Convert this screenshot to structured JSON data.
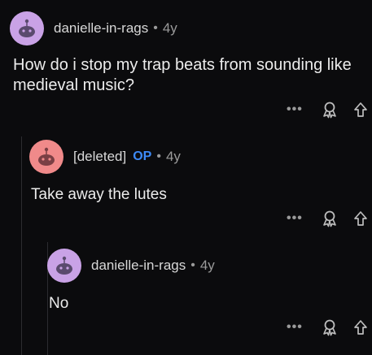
{
  "post": {
    "author": "danielle-in-rags",
    "separator": "•",
    "age": "4y",
    "title": "How do i stop my trap beats from sounding like medieval music?"
  },
  "reply1": {
    "author": "[deleted]",
    "op_badge": "OP",
    "separator": "•",
    "age": "4y",
    "body": "Take away the lutes"
  },
  "reply2": {
    "author": "danielle-in-rags",
    "separator": "•",
    "age": "4y",
    "body": "No"
  },
  "actions": {
    "more_label": "•••"
  },
  "colors": {
    "avatar_purple": "#c9a2e6",
    "avatar_pink": "#f08a8a",
    "op_blue": "#3d8af7",
    "background": "#0b0b0d"
  },
  "icons": [
    "snoo-avatar-icon",
    "more-options-icon",
    "award-icon",
    "upvote-icon"
  ]
}
